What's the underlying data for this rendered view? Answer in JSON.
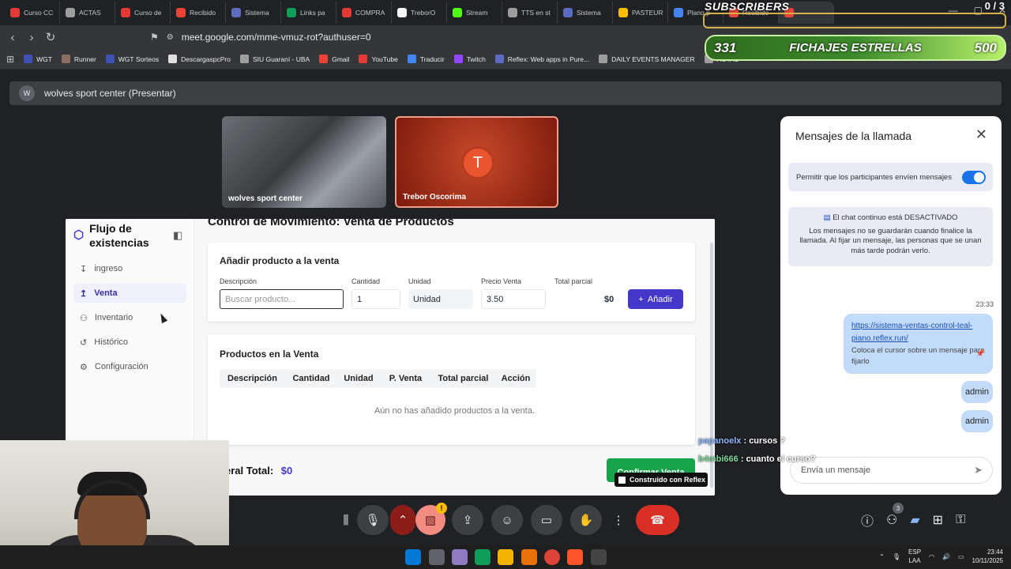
{
  "browser": {
    "tabs": [
      {
        "label": "Curso CC",
        "color": "#e53935"
      },
      {
        "label": "ACTAS",
        "color": "#9e9e9e"
      },
      {
        "label": "Curso de",
        "color": "#e53935"
      },
      {
        "label": "Recibido",
        "color": "#ea4335"
      },
      {
        "label": "Sistema",
        "color": "#5c6bc0"
      },
      {
        "label": "Links pa",
        "color": "#0f9d58"
      },
      {
        "label": "COMPRA",
        "color": "#e53935"
      },
      {
        "label": "TreborO",
        "color": "#f5f5f5"
      },
      {
        "label": "Stream",
        "color": "#53fc18"
      },
      {
        "label": "TTS en st",
        "color": "#9e9e9e"
      },
      {
        "label": "Sistema",
        "color": "#5c6bc0"
      },
      {
        "label": "PASTEUR",
        "color": "#fbbc04"
      },
      {
        "label": "Plano p",
        "color": "#4285f4"
      },
      {
        "label": "Recibido",
        "color": "#ea4335"
      },
      {
        "label": "",
        "color": "#ea4335"
      }
    ],
    "url": "meet.google.com/mme-vmuz-rot?authuser=0",
    "bookmarks": [
      {
        "label": "WGT",
        "color": "#3f51b5"
      },
      {
        "label": "Runner",
        "color": "#8d6e63"
      },
      {
        "label": "WGT Sorteos",
        "color": "#3f51b5"
      },
      {
        "label": "DescargaspcPro",
        "color": "#e0e0e0"
      },
      {
        "label": "SIU Guaraní - UBA",
        "color": "#9e9e9e"
      },
      {
        "label": "Gmail",
        "color": "#ea4335"
      },
      {
        "label": "YouTube",
        "color": "#e53935"
      },
      {
        "label": "Traducir",
        "color": "#4285f4"
      },
      {
        "label": "Twitch",
        "color": "#9146ff"
      },
      {
        "label": "Reflex: Web apps in Pure...",
        "color": "#5c6bc0"
      },
      {
        "label": "DAILY EVENTS MANAGER",
        "color": "#9e9e9e"
      },
      {
        "label": "ACTAS",
        "color": "#9e9e9e"
      }
    ]
  },
  "meet": {
    "header_avatar": "W",
    "header_title": "wolves sport center (Presentar)",
    "tile1_name": "wolves sport center",
    "tile2_initial": "T",
    "tile2_name": "Trebor Oscorima",
    "people_count": "3"
  },
  "app": {
    "brand": "Flujo de existencias",
    "nav": [
      {
        "label": "ingreso",
        "icon": "↧"
      },
      {
        "label": "Venta",
        "icon": "↥"
      },
      {
        "label": "Inventario",
        "icon": "⚇"
      },
      {
        "label": "Histórico",
        "icon": "↺"
      },
      {
        "label": "Configuración",
        "icon": "⚙"
      }
    ],
    "title": "Control de Movimiento: Venta de Productos",
    "add_card_title": "Añadir producto a la venta",
    "labels": {
      "desc": "Descripción",
      "qty": "Cantidad",
      "unit": "Unidad",
      "price": "Precio Venta",
      "partial": "Total parcial"
    },
    "fields": {
      "desc_placeholder": "Buscar producto...",
      "qty": "1",
      "unit": "Unidad",
      "price": "3.50",
      "partial": "$0"
    },
    "add_button": "Añadir",
    "list_card_title": "Productos en la Venta",
    "table_headers": [
      "Descripción",
      "Cantidad",
      "Unidad",
      "P. Venta",
      "Total parcial",
      "Acción"
    ],
    "empty_msg": "Aún no has añadido productos a la venta.",
    "total_label": "eral Total:",
    "total_value": "$0",
    "confirm_button": "Confirmar Venta",
    "reflex_badge": "Construido con Reflex"
  },
  "chat": {
    "title": "Mensajes de la llamada",
    "permit_label": "Permitir que los participantes envíen mensajes",
    "info_title": "El chat continuo está DESACTIVADO",
    "info_body": "Los mensajes no se guardarán cuando finalice la llamada. Al fijar un mensaje, las personas que se unan más tarde podrán verlo.",
    "timestamp": "23:33",
    "link": "https://sistema-ventas-control-teal-piano.reflex.run/",
    "pin_hint": "Coloca el cursor sobre un mensaje para fijarlo",
    "msg2": "admin",
    "msg3": "admin",
    "input_placeholder": "Envía un mensaje"
  },
  "overlay": {
    "subs_label": "SUBSCRIBERS",
    "subs_count": "0 / 3",
    "bar_left": "331",
    "bar_center": "FICHAJES ESTRELLAS",
    "bar_right": "500",
    "chat1_user": "papanoelx",
    "chat1_text": ": cursos ?",
    "chat2_user": "b4mbi666",
    "chat2_text": ": cuanto el curso?"
  },
  "taskbar": {
    "lang1": "ESP",
    "lang2": "LAA",
    "time": "23:44",
    "date": "10/11/2025"
  }
}
